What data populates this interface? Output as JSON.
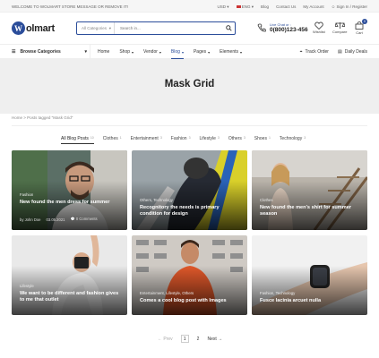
{
  "topbar": {
    "welcome": "WELCOME TO WOLMART STORE MESSAGE OR REMOVE IT!",
    "currency": "USD",
    "language": "ENG",
    "links": [
      "Blog",
      "Contact Us",
      "My Account",
      "Sign In / Register"
    ]
  },
  "header": {
    "logo_text": "olmart",
    "logo_letter": "W",
    "search_category": "All Categories",
    "search_placeholder": "Search in...",
    "call_label": "Live Chat or :",
    "call_number": "0(800)123-456",
    "wishlist": "Wishlist",
    "compare": "Compare",
    "cart": "Cart",
    "cart_count": "0"
  },
  "nav": {
    "browse": "Browse Categories",
    "items": [
      {
        "label": "Home",
        "caret": false
      },
      {
        "label": "Shop",
        "caret": true
      },
      {
        "label": "Vendor",
        "caret": true
      },
      {
        "label": "Blog",
        "caret": true
      },
      {
        "label": "Pages",
        "caret": true
      },
      {
        "label": "Elements",
        "caret": true
      }
    ],
    "track": "Track Order",
    "deals": "Daily Deals"
  },
  "banner": {
    "title": "Mask Grid"
  },
  "breadcrumb": "Home  >  Posts tagged \"Mask Grid\"",
  "filters": [
    {
      "label": "All Blog Posts",
      "count": "10"
    },
    {
      "label": "Clothes",
      "count": "1"
    },
    {
      "label": "Entertainment",
      "count": "3"
    },
    {
      "label": "Fashion",
      "count": "3"
    },
    {
      "label": "Lifestyle",
      "count": "3"
    },
    {
      "label": "Others",
      "count": "3"
    },
    {
      "label": "Shoes",
      "count": "1"
    },
    {
      "label": "Technology",
      "count": "3"
    }
  ],
  "posts": [
    {
      "category": "Fashion",
      "title": "New found the men dress for summer",
      "author": "by John Doe",
      "date": "03.05.2021",
      "comments": "0 Comments"
    },
    {
      "category": "Others, Technology",
      "title": "Recognitory the needs is primary condition for design",
      "author": "",
      "date": "",
      "comments": ""
    },
    {
      "category": "Clothes",
      "title": "New found the men's shirt for summer season",
      "author": "",
      "date": "",
      "comments": ""
    },
    {
      "category": "Lifestyle",
      "title": "We want to be different and fashion gives to me that outlet",
      "author": "",
      "date": "",
      "comments": ""
    },
    {
      "category": "Entertainment, Lifestyle, Others",
      "title": "Comes a cool blog post with Images",
      "author": "",
      "date": "",
      "comments": ""
    },
    {
      "category": "Fashion, Technology",
      "title": "Fusce lacinia arcuet nulla",
      "author": "",
      "date": "",
      "comments": ""
    }
  ],
  "pagination": {
    "prev": "Prev",
    "pages": [
      "1",
      "2"
    ],
    "next": "Next"
  },
  "colors": {
    "accent": "#2b4d9a"
  }
}
